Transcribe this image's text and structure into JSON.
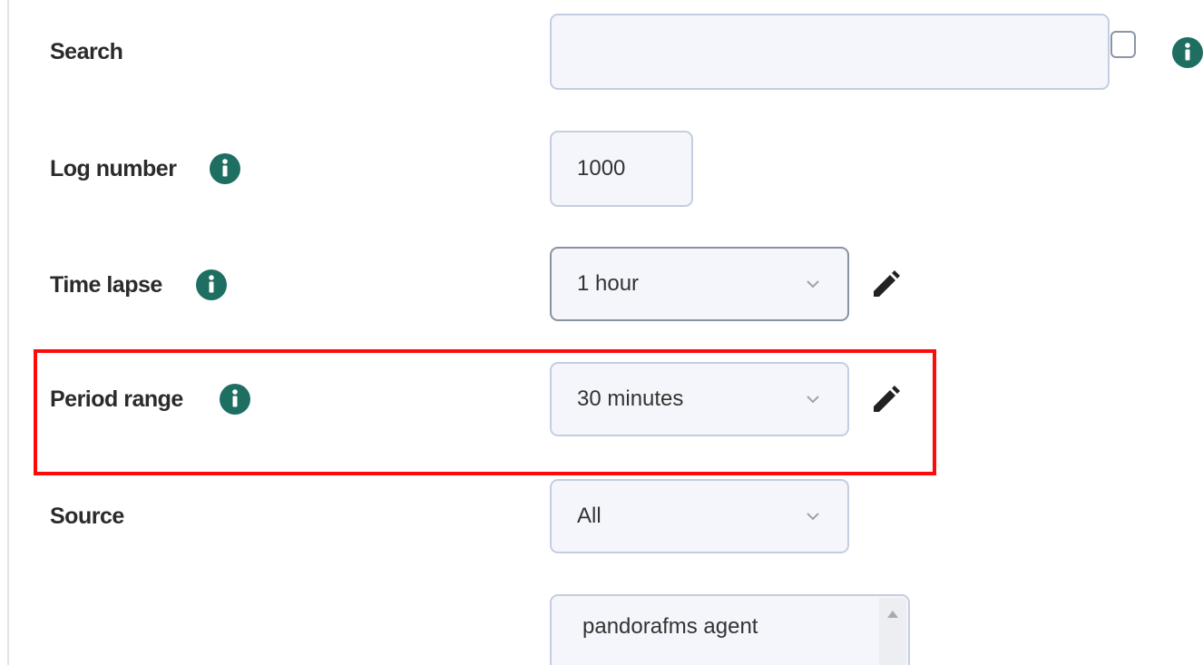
{
  "form": {
    "search": {
      "label": "Search",
      "value": ""
    },
    "log_number": {
      "label": "Log number",
      "value": "1000"
    },
    "time_lapse": {
      "label": "Time lapse",
      "selected": "1 hour"
    },
    "period_range": {
      "label": "Period range",
      "selected": "30 minutes"
    },
    "source": {
      "label": "Source",
      "selected": "All",
      "list_items": [
        "pandorafms agent"
      ]
    }
  },
  "icons": {
    "info": "info-icon",
    "edit": "pencil-icon",
    "dropdown": "chevron-down-icon"
  },
  "colors": {
    "info_icon": "#1e6e62",
    "highlight": "#ff0a0a",
    "field_bg": "#f4f6fb",
    "field_border": "#c4cee0"
  }
}
